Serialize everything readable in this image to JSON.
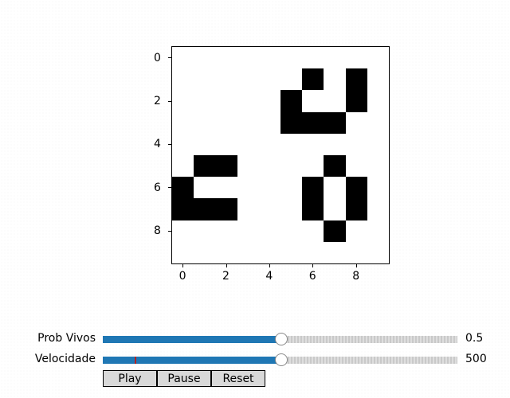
{
  "grid": {
    "rows": 10,
    "cols": 10,
    "alive": [
      [
        1,
        6
      ],
      [
        1,
        8
      ],
      [
        2,
        5
      ],
      [
        2,
        8
      ],
      [
        3,
        5
      ],
      [
        3,
        6
      ],
      [
        3,
        7
      ],
      [
        5,
        1
      ],
      [
        5,
        2
      ],
      [
        5,
        7
      ],
      [
        6,
        0
      ],
      [
        6,
        6
      ],
      [
        6,
        8
      ],
      [
        7,
        0
      ],
      [
        7,
        1
      ],
      [
        7,
        2
      ],
      [
        7,
        6
      ],
      [
        7,
        8
      ],
      [
        8,
        7
      ]
    ],
    "x_ticks": [
      "0",
      "2",
      "4",
      "6",
      "8"
    ],
    "y_ticks": [
      "0",
      "2",
      "4",
      "6",
      "8"
    ]
  },
  "sliders": [
    {
      "label": "Prob Vivos",
      "value_text": "0.5",
      "fraction": 0.5,
      "marker": null
    },
    {
      "label": "Velocidade",
      "value_text": "500",
      "fraction": 0.5,
      "marker": 0.09
    }
  ],
  "buttons": {
    "play": "Play",
    "pause": "Pause",
    "reset": "Reset"
  },
  "colors": {
    "alive": "#000000",
    "dead": "#ffffff",
    "slider_fill": "#1f77b4",
    "marker": "#b22222"
  }
}
